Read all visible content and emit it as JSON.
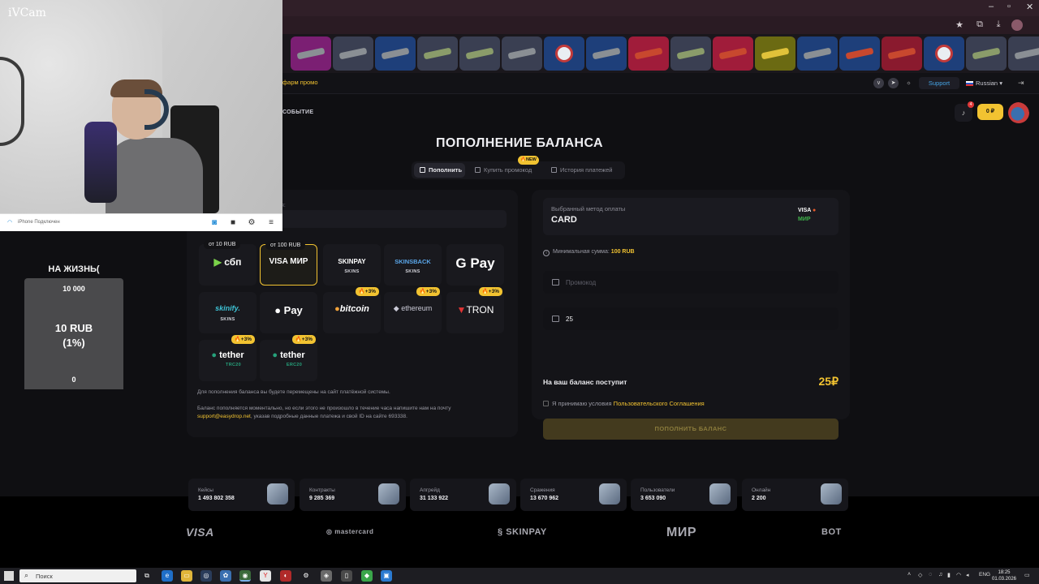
{
  "webcam": {
    "brand": "iVCam",
    "status": "iPhone Подключен",
    "wifi_icon": "wifi-icon",
    "controls": [
      "camera-icon",
      "video-icon",
      "gear-icon",
      "menu-icon"
    ]
  },
  "goal_widget": {
    "title": "НА ЖИЗНЬ(",
    "target": "10 000",
    "current": "10 RUB",
    "percent": "(1%)",
    "start": "0"
  },
  "navbar": {
    "promo_link": "фарм промо",
    "support_label": "Support",
    "language": "Russian",
    "event_link": "СОБЫТИЕ",
    "notifications_count": "4",
    "balance": "0 ₽"
  },
  "page": {
    "title": "ПОПОЛНЕНИЕ БАЛАНСА",
    "tabs": [
      "Пополнить",
      "Купить промокод",
      "История платежей"
    ],
    "new_badge": "🔥NEW"
  },
  "methods_panel": {
    "field_label_fragment": "ля:",
    "methods": [
      {
        "logo": "сбп",
        "tag": "от 10 RUB"
      },
      {
        "logo": "VISA МИР",
        "tag": "от 100 RUB"
      },
      {
        "logo": "SKINPAY",
        "sub": "SKINS"
      },
      {
        "logo": "SKINSBACK",
        "sub": "SKINS"
      },
      {
        "logo": "G Pay"
      },
      {
        "logo": "skinify.",
        "sub": "SKINS"
      },
      {
        "logo": " Pay"
      },
      {
        "logo": "bitcoin",
        "bonus": "🔥+3%"
      },
      {
        "logo": "ethereum",
        "bonus": "🔥+3%"
      },
      {
        "logo": "TRON",
        "bonus": "🔥+3%"
      },
      {
        "logo": "tether",
        "sub": "TRC20",
        "bonus": "🔥+3%"
      },
      {
        "logo": "tether",
        "sub": "ERC20",
        "bonus": "🔥+3%"
      }
    ],
    "note1": "Для пополнения баланса вы будете перемещены на сайт платёжной системы.",
    "note2_a": "Баланс пополняется моментально, но если этого не произошло в течение часа напишите нам на почту",
    "note2_email": "support@easydrop.net",
    "note2_b": ", указав подробные данные платежа и свой ID на сайте 693338."
  },
  "checkout": {
    "selected_label": "Выбранный метод оплаты",
    "selected_value": "CARD",
    "min_label": "Минимальная сумма:",
    "min_value": "100 RUB",
    "promo_placeholder": "Промокод",
    "amount_value": "25",
    "receive_label": "На ваш баланс поступит",
    "receive_value": "25₽",
    "terms_text": "Я принимаю условия",
    "terms_link": "Пользовательского Соглашения",
    "submit_label": "ПОПОЛНИТЬ БАЛАНС"
  },
  "stats": [
    {
      "label": "Кейсы",
      "value": "1 493 802 358"
    },
    {
      "label": "Контракты",
      "value": "9 285 369"
    },
    {
      "label": "Апгрейд",
      "value": "31 133 922"
    },
    {
      "label": "Сражения",
      "value": "13 670 962"
    },
    {
      "label": "Пользователи",
      "value": "3 653 090"
    },
    {
      "label": "Онлайн",
      "value": "2 200"
    }
  ],
  "footer_logos": [
    "VISA",
    "mastercard",
    "SKINPAY",
    "МИР",
    "BOT"
  ],
  "taskbar": {
    "search_placeholder": "Поиск",
    "lang": "ENG",
    "time": "18:25",
    "date": "01.03.2026"
  },
  "colors": {
    "accent": "#f2c331",
    "background": "#0f0f12",
    "panel": "#141418",
    "link_blue": "#46a6e8"
  }
}
